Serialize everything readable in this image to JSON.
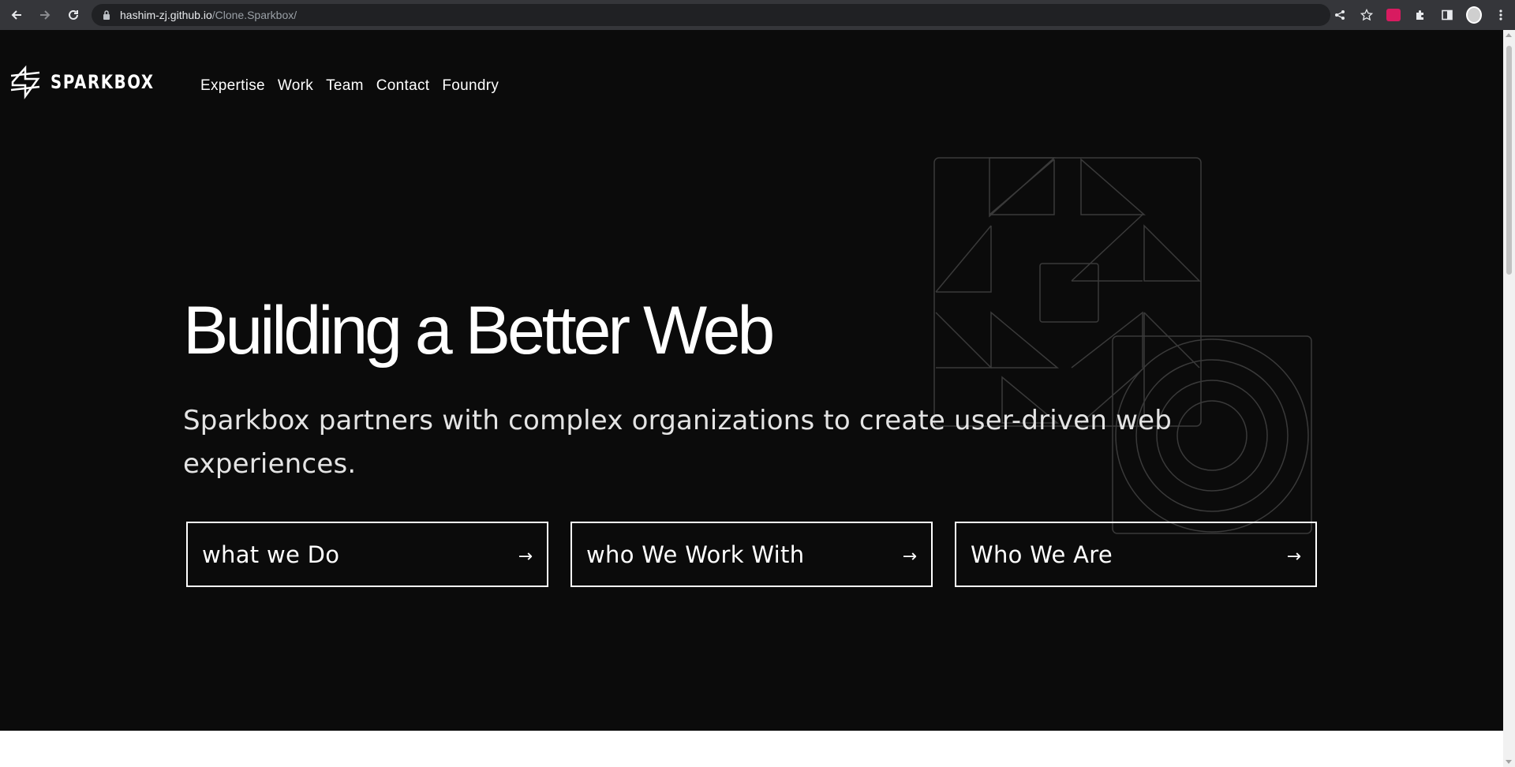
{
  "browser": {
    "url_host": "hashim-zj.github.io",
    "url_path": "/Clone.Sparkbox/"
  },
  "header": {
    "logo_text": "SPARKBOX",
    "nav": [
      {
        "label": "Expertise"
      },
      {
        "label": "Work"
      },
      {
        "label": "Team"
      },
      {
        "label": "Contact"
      },
      {
        "label": "Foundry"
      }
    ]
  },
  "hero": {
    "title": "Building a Better Web",
    "subtitle": "Sparkbox partners with complex organizations to create user-driven web experiences."
  },
  "ctas": [
    {
      "label": "what we Do",
      "arrow": "→"
    },
    {
      "label": "who We Work With",
      "arrow": "→"
    },
    {
      "label": "Who We Are",
      "arrow": "→"
    }
  ],
  "colors": {
    "page_bg": "#0b0b0b",
    "text": "#ffffff",
    "art_stroke": "#3a3a3a"
  }
}
